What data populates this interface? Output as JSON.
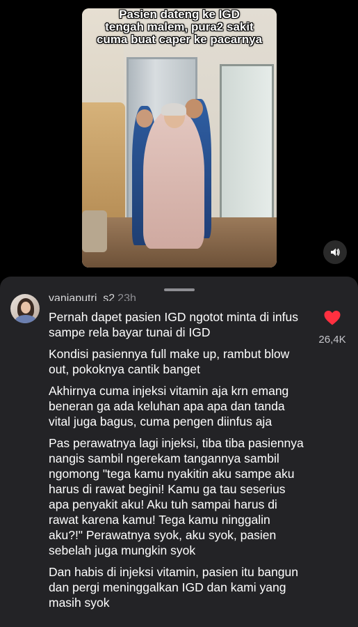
{
  "video": {
    "caption_lines": [
      "Pasien dateng ke IGD",
      "tengah malem, pura2 sakit",
      "cuma buat caper ke pacarnya"
    ],
    "sound_icon": "speaker-icon"
  },
  "comment": {
    "username": "vaniaputri_s2",
    "time": "23h",
    "paragraphs": [
      "Pernah dapet pasien IGD ngotot minta di infus sampe rela bayar tunai di IGD",
      "Kondisi pasiennya full make up, rambut blow out, pokoknya cantik banget",
      "Akhirnya cuma injeksi vitamin aja krn emang beneran ga ada keluhan apa apa dan tanda vital juga bagus, cuma pengen diinfus aja",
      "Pas perawatnya lagi injeksi, tiba tiba pasiennya nangis sambil ngerekam tangannya sambil ngomong \"tega kamu nyakitin aku sampe aku harus di rawat begini! Kamu ga tau seserius apa penyakit aku! Aku tuh sampai harus di rawat karena kamu! Tega kamu ninggalin aku?!\" Perawatnya syok, aku syok, pasien sebelah juga mungkin syok",
      "Dan habis di injeksi vitamin, pasien itu bangun dan pergi meninggalkan IGD dan kami yang masih syok"
    ],
    "likes": "26,4K",
    "like_color": "#ff3040"
  }
}
